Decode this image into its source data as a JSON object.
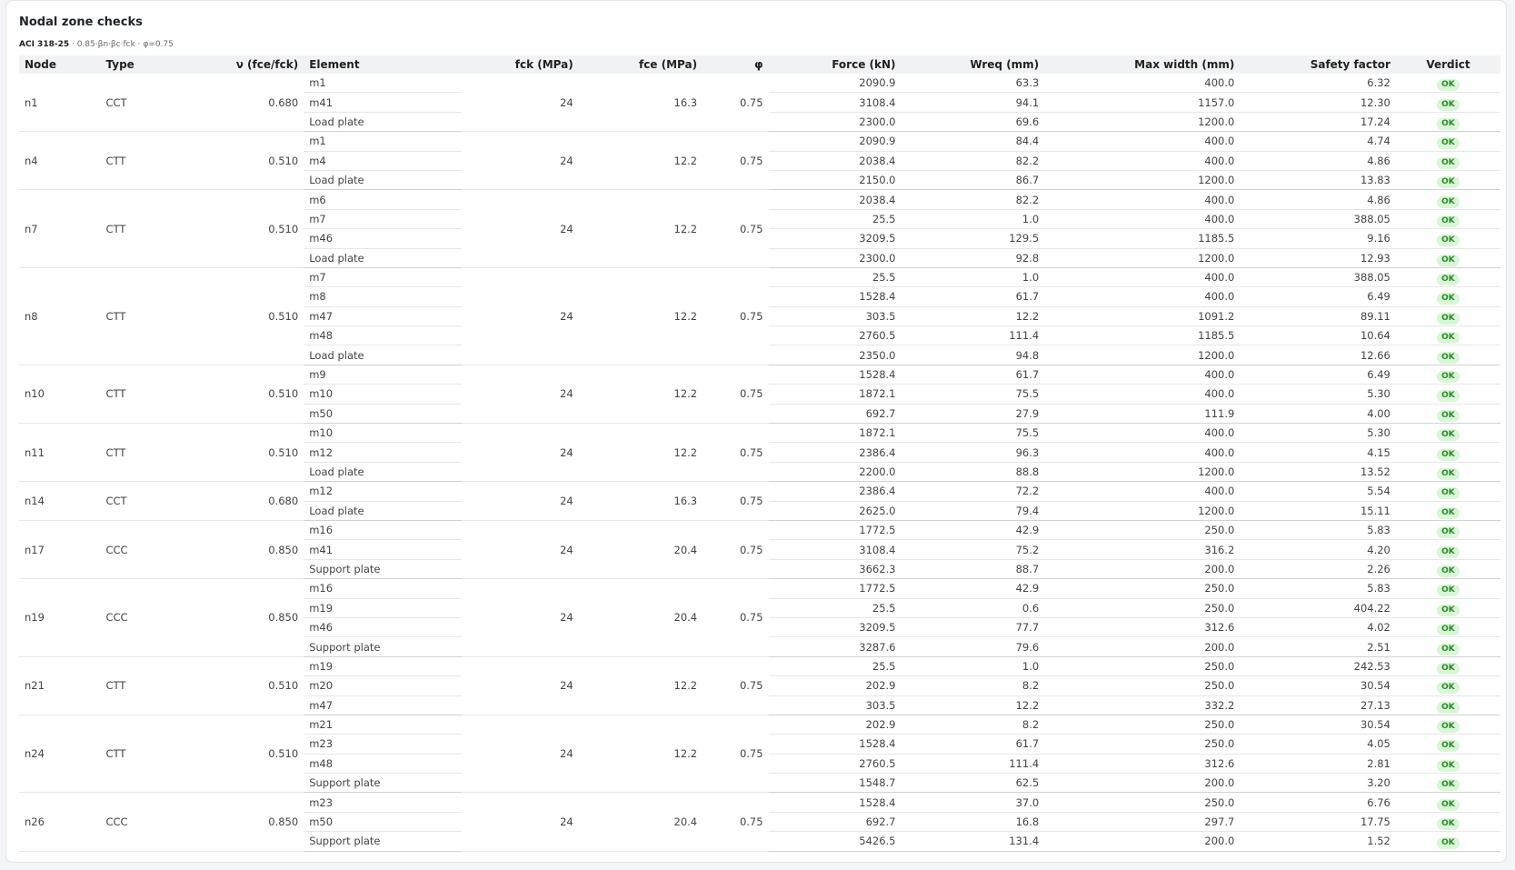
{
  "header": {
    "title": "Nodal zone checks",
    "code": "ACI 318-25",
    "formula": " · 0.85·βn·βc·fck · φ=0.75"
  },
  "columns": [
    "Node",
    "Type",
    "ν (fce/fck)",
    "Element",
    "fck (MPa)",
    "fce (MPa)",
    "φ",
    "Force (kN)",
    "Wreq (mm)",
    "Max width (mm)",
    "Safety factor",
    "Verdict"
  ],
  "nodes": [
    {
      "node": "n1",
      "type": "CCT",
      "nu": "0.680",
      "fck": "24",
      "fce": "16.3",
      "phi": "0.75",
      "rows": [
        {
          "element": "m1",
          "force": "2090.9",
          "wreq": "63.3",
          "maxw": "400.0",
          "sf": "6.32",
          "verdict": "OK"
        },
        {
          "element": "m41",
          "force": "3108.4",
          "wreq": "94.1",
          "maxw": "1157.0",
          "sf": "12.30",
          "verdict": "OK"
        },
        {
          "element": "Load plate",
          "force": "2300.0",
          "wreq": "69.6",
          "maxw": "1200.0",
          "sf": "17.24",
          "verdict": "OK"
        }
      ]
    },
    {
      "node": "n4",
      "type": "CTT",
      "nu": "0.510",
      "fck": "24",
      "fce": "12.2",
      "phi": "0.75",
      "rows": [
        {
          "element": "m1",
          "force": "2090.9",
          "wreq": "84.4",
          "maxw": "400.0",
          "sf": "4.74",
          "verdict": "OK"
        },
        {
          "element": "m4",
          "force": "2038.4",
          "wreq": "82.2",
          "maxw": "400.0",
          "sf": "4.86",
          "verdict": "OK"
        },
        {
          "element": "Load plate",
          "force": "2150.0",
          "wreq": "86.7",
          "maxw": "1200.0",
          "sf": "13.83",
          "verdict": "OK"
        }
      ]
    },
    {
      "node": "n7",
      "type": "CTT",
      "nu": "0.510",
      "fck": "24",
      "fce": "12.2",
      "phi": "0.75",
      "rows": [
        {
          "element": "m6",
          "force": "2038.4",
          "wreq": "82.2",
          "maxw": "400.0",
          "sf": "4.86",
          "verdict": "OK"
        },
        {
          "element": "m7",
          "force": "25.5",
          "wreq": "1.0",
          "maxw": "400.0",
          "sf": "388.05",
          "verdict": "OK"
        },
        {
          "element": "m46",
          "force": "3209.5",
          "wreq": "129.5",
          "maxw": "1185.5",
          "sf": "9.16",
          "verdict": "OK"
        },
        {
          "element": "Load plate",
          "force": "2300.0",
          "wreq": "92.8",
          "maxw": "1200.0",
          "sf": "12.93",
          "verdict": "OK"
        }
      ]
    },
    {
      "node": "n8",
      "type": "CTT",
      "nu": "0.510",
      "fck": "24",
      "fce": "12.2",
      "phi": "0.75",
      "rows": [
        {
          "element": "m7",
          "force": "25.5",
          "wreq": "1.0",
          "maxw": "400.0",
          "sf": "388.05",
          "verdict": "OK"
        },
        {
          "element": "m8",
          "force": "1528.4",
          "wreq": "61.7",
          "maxw": "400.0",
          "sf": "6.49",
          "verdict": "OK"
        },
        {
          "element": "m47",
          "force": "303.5",
          "wreq": "12.2",
          "maxw": "1091.2",
          "sf": "89.11",
          "verdict": "OK"
        },
        {
          "element": "m48",
          "force": "2760.5",
          "wreq": "111.4",
          "maxw": "1185.5",
          "sf": "10.64",
          "verdict": "OK"
        },
        {
          "element": "Load plate",
          "force": "2350.0",
          "wreq": "94.8",
          "maxw": "1200.0",
          "sf": "12.66",
          "verdict": "OK"
        }
      ]
    },
    {
      "node": "n10",
      "type": "CTT",
      "nu": "0.510",
      "fck": "24",
      "fce": "12.2",
      "phi": "0.75",
      "rows": [
        {
          "element": "m9",
          "force": "1528.4",
          "wreq": "61.7",
          "maxw": "400.0",
          "sf": "6.49",
          "verdict": "OK"
        },
        {
          "element": "m10",
          "force": "1872.1",
          "wreq": "75.5",
          "maxw": "400.0",
          "sf": "5.30",
          "verdict": "OK"
        },
        {
          "element": "m50",
          "force": "692.7",
          "wreq": "27.9",
          "maxw": "111.9",
          "sf": "4.00",
          "verdict": "OK"
        }
      ]
    },
    {
      "node": "n11",
      "type": "CTT",
      "nu": "0.510",
      "fck": "24",
      "fce": "12.2",
      "phi": "0.75",
      "rows": [
        {
          "element": "m10",
          "force": "1872.1",
          "wreq": "75.5",
          "maxw": "400.0",
          "sf": "5.30",
          "verdict": "OK"
        },
        {
          "element": "m12",
          "force": "2386.4",
          "wreq": "96.3",
          "maxw": "400.0",
          "sf": "4.15",
          "verdict": "OK"
        },
        {
          "element": "Load plate",
          "force": "2200.0",
          "wreq": "88.8",
          "maxw": "1200.0",
          "sf": "13.52",
          "verdict": "OK"
        }
      ]
    },
    {
      "node": "n14",
      "type": "CCT",
      "nu": "0.680",
      "fck": "24",
      "fce": "16.3",
      "phi": "0.75",
      "rows": [
        {
          "element": "m12",
          "force": "2386.4",
          "wreq": "72.2",
          "maxw": "400.0",
          "sf": "5.54",
          "verdict": "OK"
        },
        {
          "element": "Load plate",
          "force": "2625.0",
          "wreq": "79.4",
          "maxw": "1200.0",
          "sf": "15.11",
          "verdict": "OK"
        }
      ]
    },
    {
      "node": "n17",
      "type": "CCC",
      "nu": "0.850",
      "fck": "24",
      "fce": "20.4",
      "phi": "0.75",
      "rows": [
        {
          "element": "m16",
          "force": "1772.5",
          "wreq": "42.9",
          "maxw": "250.0",
          "sf": "5.83",
          "verdict": "OK"
        },
        {
          "element": "m41",
          "force": "3108.4",
          "wreq": "75.2",
          "maxw": "316.2",
          "sf": "4.20",
          "verdict": "OK"
        },
        {
          "element": "Support plate",
          "force": "3662.3",
          "wreq": "88.7",
          "maxw": "200.0",
          "sf": "2.26",
          "verdict": "OK"
        }
      ]
    },
    {
      "node": "n19",
      "type": "CCC",
      "nu": "0.850",
      "fck": "24",
      "fce": "20.4",
      "phi": "0.75",
      "rows": [
        {
          "element": "m16",
          "force": "1772.5",
          "wreq": "42.9",
          "maxw": "250.0",
          "sf": "5.83",
          "verdict": "OK"
        },
        {
          "element": "m19",
          "force": "25.5",
          "wreq": "0.6",
          "maxw": "250.0",
          "sf": "404.22",
          "verdict": "OK"
        },
        {
          "element": "m46",
          "force": "3209.5",
          "wreq": "77.7",
          "maxw": "312.6",
          "sf": "4.02",
          "verdict": "OK"
        },
        {
          "element": "Support plate",
          "force": "3287.6",
          "wreq": "79.6",
          "maxw": "200.0",
          "sf": "2.51",
          "verdict": "OK"
        }
      ]
    },
    {
      "node": "n21",
      "type": "CTT",
      "nu": "0.510",
      "fck": "24",
      "fce": "12.2",
      "phi": "0.75",
      "rows": [
        {
          "element": "m19",
          "force": "25.5",
          "wreq": "1.0",
          "maxw": "250.0",
          "sf": "242.53",
          "verdict": "OK"
        },
        {
          "element": "m20",
          "force": "202.9",
          "wreq": "8.2",
          "maxw": "250.0",
          "sf": "30.54",
          "verdict": "OK"
        },
        {
          "element": "m47",
          "force": "303.5",
          "wreq": "12.2",
          "maxw": "332.2",
          "sf": "27.13",
          "verdict": "OK"
        }
      ]
    },
    {
      "node": "n24",
      "type": "CTT",
      "nu": "0.510",
      "fck": "24",
      "fce": "12.2",
      "phi": "0.75",
      "rows": [
        {
          "element": "m21",
          "force": "202.9",
          "wreq": "8.2",
          "maxw": "250.0",
          "sf": "30.54",
          "verdict": "OK"
        },
        {
          "element": "m23",
          "force": "1528.4",
          "wreq": "61.7",
          "maxw": "250.0",
          "sf": "4.05",
          "verdict": "OK"
        },
        {
          "element": "m48",
          "force": "2760.5",
          "wreq": "111.4",
          "maxw": "312.6",
          "sf": "2.81",
          "verdict": "OK"
        },
        {
          "element": "Support plate",
          "force": "1548.7",
          "wreq": "62.5",
          "maxw": "200.0",
          "sf": "3.20",
          "verdict": "OK"
        }
      ]
    },
    {
      "node": "n26",
      "type": "CCC",
      "nu": "0.850",
      "fck": "24",
      "fce": "20.4",
      "phi": "0.75",
      "rows": [
        {
          "element": "m23",
          "force": "1528.4",
          "wreq": "37.0",
          "maxw": "250.0",
          "sf": "6.76",
          "verdict": "OK"
        },
        {
          "element": "m50",
          "force": "692.7",
          "wreq": "16.8",
          "maxw": "297.7",
          "sf": "17.75",
          "verdict": "OK"
        },
        {
          "element": "Support plate",
          "force": "5426.5",
          "wreq": "131.4",
          "maxw": "200.0",
          "sf": "1.52",
          "verdict": "OK"
        }
      ]
    }
  ],
  "colors": {
    "ok_bg": "#d9f6d6",
    "ok_text": "#2a8a2a"
  }
}
